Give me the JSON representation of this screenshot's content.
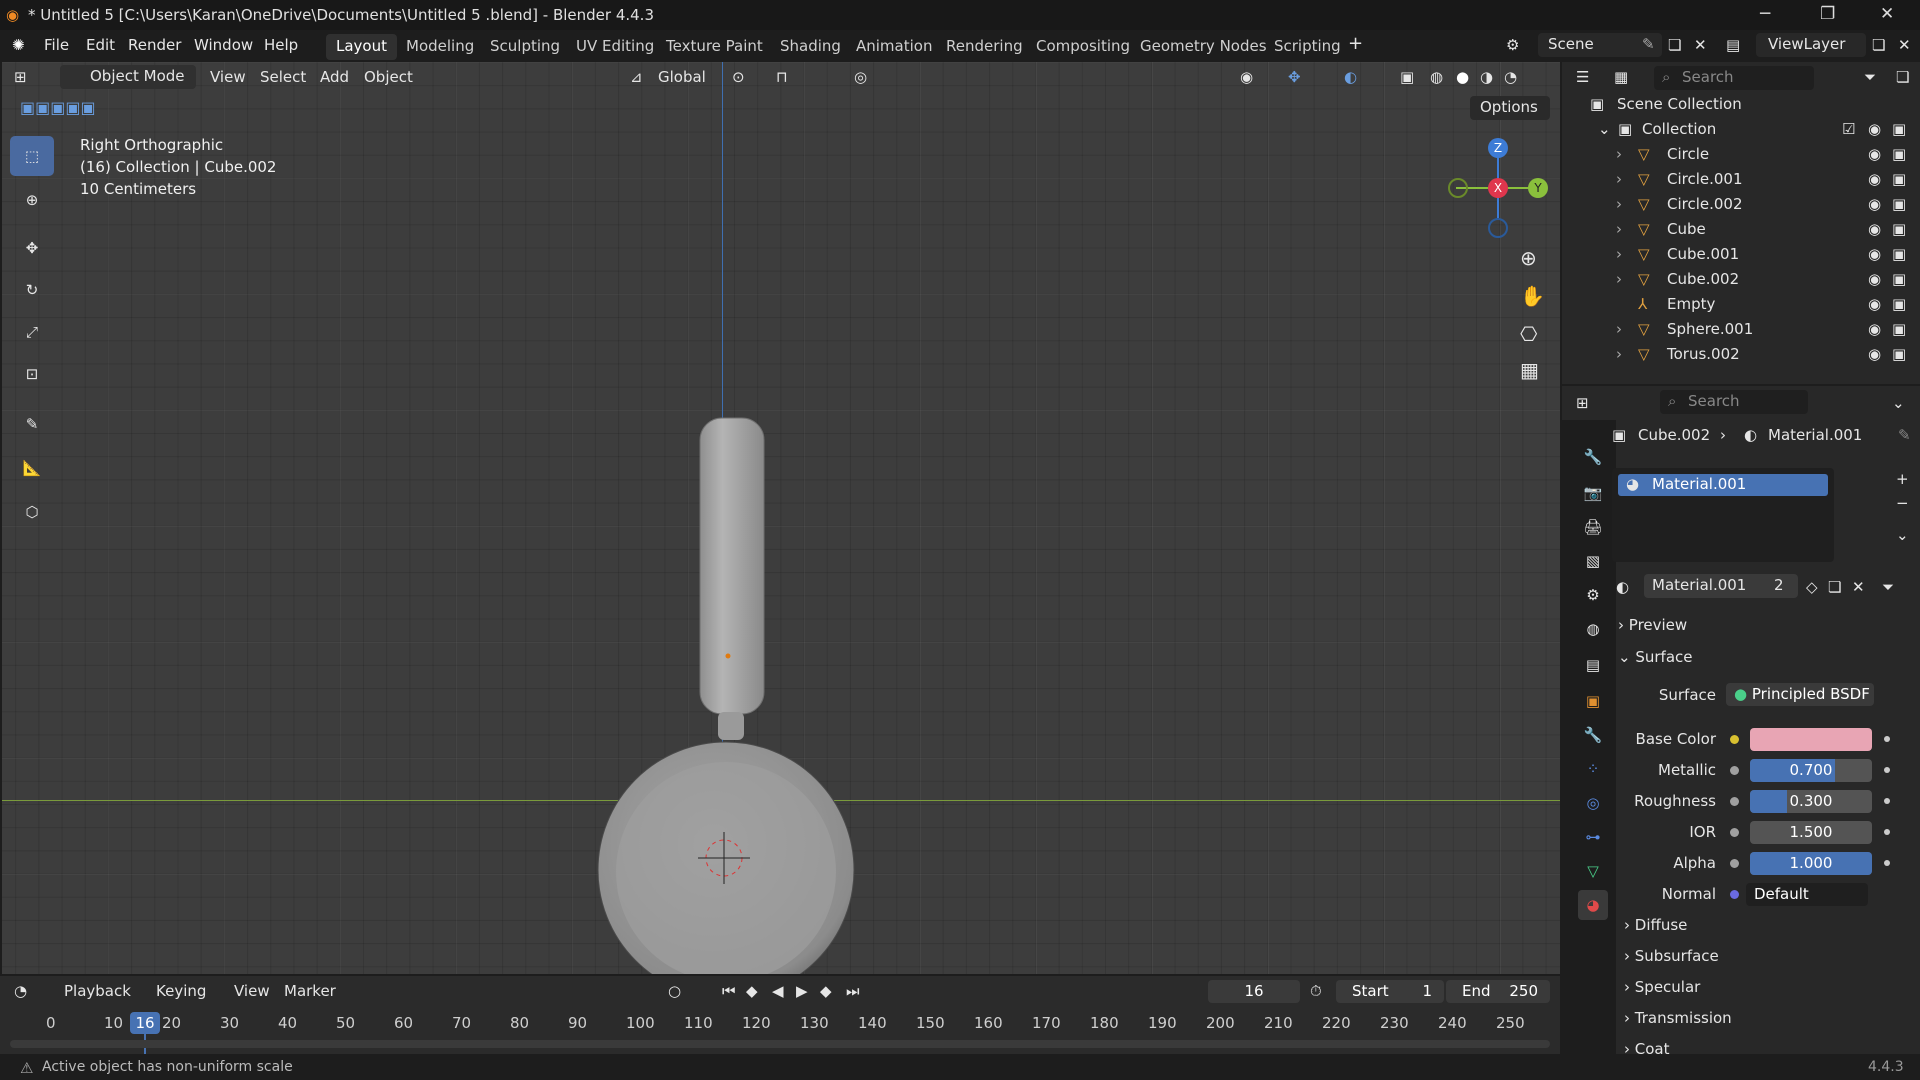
{
  "window": {
    "title": "* Untitled 5  [C:\\Users\\Karan\\OneDrive\\Documents\\Untitled 5 .blend] - Blender 4.4.3"
  },
  "menu": [
    "File",
    "Edit",
    "Render",
    "Window",
    "Help"
  ],
  "workspaces": [
    "Layout",
    "Modeling",
    "Sculpting",
    "UV Editing",
    "Texture Paint",
    "Shading",
    "Animation",
    "Rendering",
    "Compositing",
    "Geometry Nodes",
    "Scripting"
  ],
  "active_workspace": "Layout",
  "scene": {
    "name": "Scene",
    "view_layer": "ViewLayer"
  },
  "viewport_header": {
    "mode": "Object Mode",
    "menus": [
      "View",
      "Select",
      "Add",
      "Object"
    ],
    "orientation": "Global",
    "options": "Options"
  },
  "viewport_info": {
    "view": "Right Orthographic",
    "collection": "(16) Collection | Cube.002",
    "scale": "10 Centimeters"
  },
  "gizmo": {
    "x": "X",
    "y": "Y",
    "z": "Z"
  },
  "outliner": {
    "search_placeholder": "Search",
    "root": "Scene Collection",
    "collection": "Collection",
    "items": [
      "Circle",
      "Circle.001",
      "Circle.002",
      "Cube",
      "Cube.001",
      "Cube.002",
      "Empty",
      "Sphere.001",
      "Torus.002"
    ]
  },
  "properties": {
    "search_placeholder": "Search",
    "breadcrumb_object": "Cube.002",
    "breadcrumb_material": "Material.001",
    "slot": "Material.001",
    "material_name": "Material.001",
    "users": "2",
    "sections": {
      "preview": "Preview",
      "surface": "Surface"
    },
    "surface": {
      "label": "Surface",
      "shader": "Principled BSDF"
    },
    "fields": [
      {
        "label": "Base Color",
        "value": "",
        "color": "#e8a5b4"
      },
      {
        "label": "Metallic",
        "value": "0.700",
        "fill": 0.7
      },
      {
        "label": "Roughness",
        "value": "0.300",
        "fill": 0.3
      },
      {
        "label": "IOR",
        "value": "1.500",
        "fill": 0
      },
      {
        "label": "Alpha",
        "value": "1.000",
        "fill": 1
      },
      {
        "label": "Normal",
        "value": "Default"
      }
    ],
    "subsections": [
      "Diffuse",
      "Subsurface",
      "Specular",
      "Transmission",
      "Coat"
    ]
  },
  "timeline": {
    "menus": [
      "Playback",
      "Keying",
      "View",
      "Marker"
    ],
    "current_frame": "16",
    "start_label": "Start",
    "start": "1",
    "end_label": "End",
    "end": "250",
    "ticks": [
      "0",
      "10",
      "20",
      "30",
      "40",
      "50",
      "60",
      "70",
      "80",
      "90",
      "100",
      "110",
      "120",
      "130",
      "140",
      "150",
      "160",
      "170",
      "180",
      "190",
      "200",
      "210",
      "220",
      "230",
      "240",
      "250"
    ]
  },
  "status": {
    "message": "Active object has non-uniform scale",
    "version": "4.4.3"
  }
}
